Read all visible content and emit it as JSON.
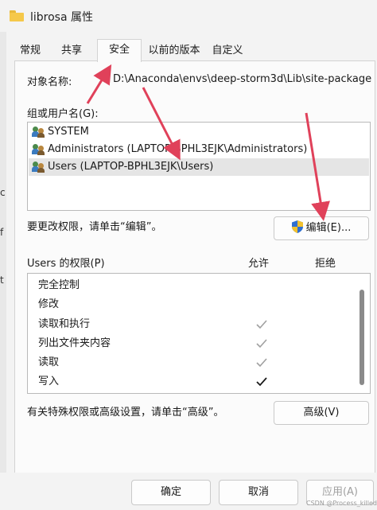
{
  "window": {
    "title": "librosa 属性",
    "left_edge_glyphs": [
      "c",
      "f",
      "t"
    ]
  },
  "tabs": [
    {
      "label": "常规"
    },
    {
      "label": "共享"
    },
    {
      "label": "安全",
      "active": true
    },
    {
      "label": "以前的版本"
    },
    {
      "label": "自定义"
    }
  ],
  "security": {
    "object_name_label": "对象名称:",
    "object_name_value": "D:\\Anaconda\\envs\\deep-storm3d\\Lib\\site-package",
    "group_label": "组或用户名(G):",
    "users": [
      {
        "name": "SYSTEM",
        "icon": "users-icon"
      },
      {
        "name": "Administrators (LAPTOP-BPHL3EJK\\Administrators)",
        "icon": "users-icon"
      },
      {
        "name": "Users (LAPTOP-BPHL3EJK\\Users)",
        "icon": "users-icon",
        "selected": true
      }
    ],
    "edit_hint": "要更改权限，请单击“编辑”。",
    "edit_button": "编辑(E)...",
    "permissions_title": "Users 的权限(P)",
    "allow_header": "允许",
    "deny_header": "拒绝",
    "permissions": [
      {
        "name": "完全控制",
        "allow": "none"
      },
      {
        "name": "修改",
        "allow": "none"
      },
      {
        "name": "读取和执行",
        "allow": "inherited"
      },
      {
        "name": "列出文件夹内容",
        "allow": "inherited"
      },
      {
        "name": "读取",
        "allow": "inherited"
      },
      {
        "name": "写入",
        "allow": "explicit"
      }
    ],
    "special_hint": "有关特殊权限或高级设置，请单击“高级”。",
    "advanced_button": "高级(V)"
  },
  "footer": {
    "ok": "确定",
    "cancel": "取消",
    "apply": "应用(A)",
    "watermark": "CSDN @Process_killed"
  },
  "colors": {
    "annotation_arrow": "#e0415a",
    "inherited_check": "#a0a0a0",
    "explicit_check": "#1a1a1a"
  }
}
